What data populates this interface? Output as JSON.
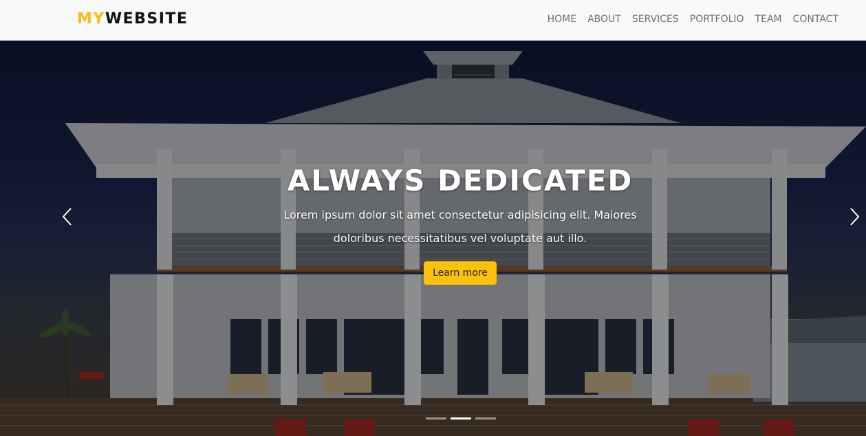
{
  "brand": {
    "part1": "MY",
    "part2": "WEBSITE"
  },
  "nav": {
    "items": [
      "HOME",
      "ABOUT",
      "SERVICES",
      "PORTFOLIO",
      "TEAM",
      "CONTACT"
    ]
  },
  "hero": {
    "headline": "ALWAYS DEDICATED",
    "lead": "Lorem ipsum dolor sit amet consectetur adipisicing elit. Maiores doloribus necessitatibus vel voluptate aut illo.",
    "button_label": "Learn more",
    "prev_icon": "chevron-left-icon",
    "next_icon": "chevron-right-icon",
    "active_slide": 2,
    "slide_count": 3
  },
  "colors": {
    "accent": "#fcc10b",
    "brand_accent": "#f8bf13",
    "nav_bg": "#f8f9fa"
  }
}
